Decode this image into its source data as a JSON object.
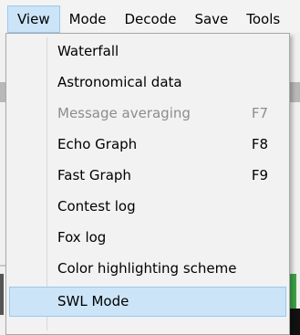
{
  "menubar": {
    "items": [
      {
        "label": "View",
        "active": true
      },
      {
        "label": "Mode"
      },
      {
        "label": "Decode"
      },
      {
        "label": "Save"
      },
      {
        "label": "Tools"
      }
    ]
  },
  "view_menu": {
    "items": [
      {
        "label": "Waterfall",
        "shortcut": "",
        "enabled": true
      },
      {
        "label": "Astronomical data",
        "shortcut": "",
        "enabled": true
      },
      {
        "label": "Message averaging",
        "shortcut": "F7",
        "enabled": false
      },
      {
        "label": "Echo Graph",
        "shortcut": "F8",
        "enabled": true
      },
      {
        "label": "Fast Graph",
        "shortcut": "F9",
        "enabled": true
      },
      {
        "label": "Contest log",
        "shortcut": "",
        "enabled": true
      },
      {
        "label": "Fox log",
        "shortcut": "",
        "enabled": true
      },
      {
        "label": "Color highlighting scheme",
        "shortcut": "",
        "enabled": true
      },
      {
        "label": "SWL Mode",
        "shortcut": "",
        "enabled": true,
        "hovered": true
      }
    ]
  },
  "colors": {
    "highlight_fill": "#cce4f7",
    "highlight_border": "#99c9ef",
    "disabled_text": "#8d8d8d"
  }
}
